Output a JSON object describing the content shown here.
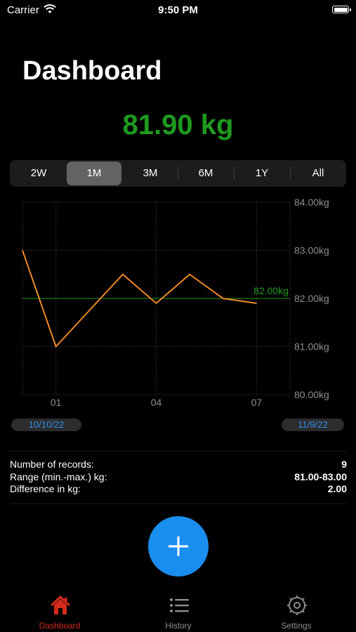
{
  "status_bar": {
    "carrier": "Carrier",
    "time": "9:50 PM"
  },
  "title": "Dashboard",
  "current_weight": "81.90 kg",
  "range_tabs": [
    {
      "label": "2W",
      "selected": false
    },
    {
      "label": "1M",
      "selected": true
    },
    {
      "label": "3M",
      "selected": false
    },
    {
      "label": "6M",
      "selected": false
    },
    {
      "label": "1Y",
      "selected": false
    },
    {
      "label": "All",
      "selected": false
    }
  ],
  "chart_data": {
    "type": "line",
    "x": [
      0,
      1,
      2,
      3,
      4,
      5,
      6,
      7,
      8
    ],
    "y_ticks": [
      "84.00kg",
      "83.00kg",
      "82.00kg",
      "81.00kg",
      "80.00kg"
    ],
    "x_ticks": [
      {
        "label": "01",
        "x": 1
      },
      {
        "label": "04",
        "x": 4
      },
      {
        "label": "07",
        "x": 7
      }
    ],
    "series": [
      {
        "values": [
          83.0,
          81.0,
          81.75,
          82.5,
          81.9,
          82.5,
          82.0,
          81.9
        ],
        "color": "#f08a24"
      }
    ],
    "goal_line": {
      "value": 82.0,
      "label": "82.00kg",
      "color": "#1e9a1e"
    },
    "ylim": [
      80,
      84
    ],
    "grid": true
  },
  "date_range": {
    "start": "10/10/22",
    "end": "11/9/22"
  },
  "stats": [
    {
      "label": "Number of records:",
      "value": "9"
    },
    {
      "label": "Range (min.-max.) kg:",
      "value": "81.00-83.00"
    },
    {
      "label": "Difference in kg:",
      "value": "2.00"
    }
  ],
  "tab_bar": [
    {
      "label": "Dashboard",
      "icon": "house-icon",
      "selected": true
    },
    {
      "label": "History",
      "icon": "list-icon",
      "selected": false
    },
    {
      "label": "Settings",
      "icon": "gear-icon",
      "selected": false
    }
  ],
  "colors": {
    "accent_green": "#1e9a1e",
    "line_orange": "#f08a24",
    "button_blue": "#1a8df0",
    "tab_active_red": "#d42a1b"
  }
}
